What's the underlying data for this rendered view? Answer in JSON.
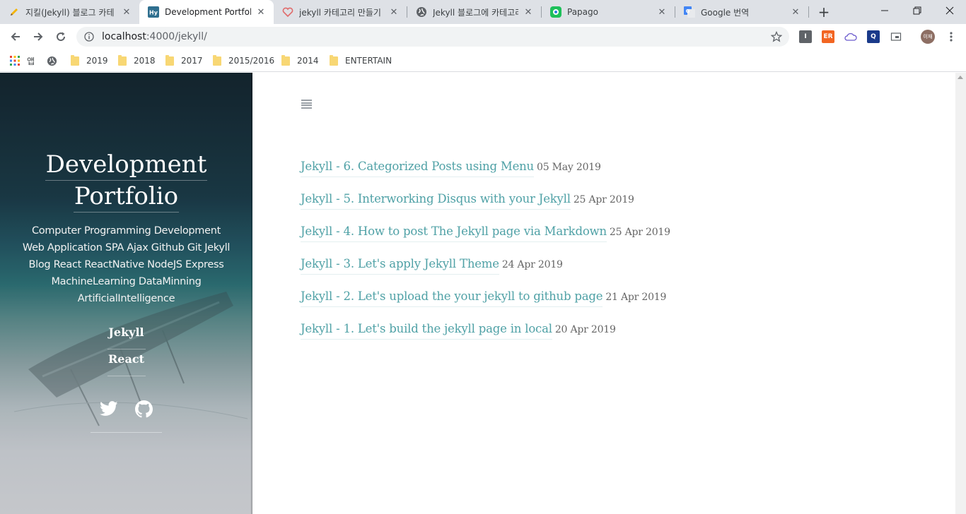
{
  "browser": {
    "tabs": [
      {
        "title": "지킬(Jekyll) 블로그 카테",
        "favicon": "pencil-icon"
      },
      {
        "title": "Development Portfolio",
        "favicon": "hy-icon",
        "active": true
      },
      {
        "title": "jekyll 카테고리 만들기",
        "favicon": "heart-icon"
      },
      {
        "title": "Jekyll 블로그에 카테고리",
        "favicon": "globe-icon"
      },
      {
        "title": "Papago",
        "favicon": "papago-icon"
      },
      {
        "title": "Google 번역",
        "favicon": "google-translate-icon"
      }
    ],
    "url_host": "localhost",
    "url_rest": ":4000/jekyll/",
    "profile_initials": "이재",
    "bookmarks": {
      "apps_label": "앱",
      "folders": [
        "2019",
        "2018",
        "2017",
        "2015/2016",
        "2014",
        "ENTERTAIN"
      ]
    }
  },
  "sidebar": {
    "title_line1": "Development",
    "title_line2": "Portfolio",
    "description": "Computer Programming Development Web Application SPA Ajax Github Git Jekyll Blog React ReactNative NodeJS Express MachineLearning DataMinning ArtificialIntelligence",
    "nav": [
      "Jekyll",
      "React"
    ]
  },
  "posts": [
    {
      "title": "Jekyll - 6. Categorized Posts using Menu",
      "date": "05 May 2019"
    },
    {
      "title": "Jekyll - 5. Interworking Disqus with your Jekyll",
      "date": "25 Apr 2019"
    },
    {
      "title": "Jekyll - 4. How to post The Jekyll page via Markdown",
      "date": "25 Apr 2019"
    },
    {
      "title": "Jekyll - 3. Let's apply Jekyll Theme",
      "date": "24 Apr 2019"
    },
    {
      "title": "Jekyll - 2. Let's upload the your jekyll to github page",
      "date": "21 Apr 2019"
    },
    {
      "title": "Jekyll - 1. Let's build the jekyll page in local",
      "date": "20 Apr 2019"
    }
  ],
  "colors": {
    "link": "#4fa1a6",
    "date": "#666666",
    "tabstrip": "#dee1e6"
  }
}
